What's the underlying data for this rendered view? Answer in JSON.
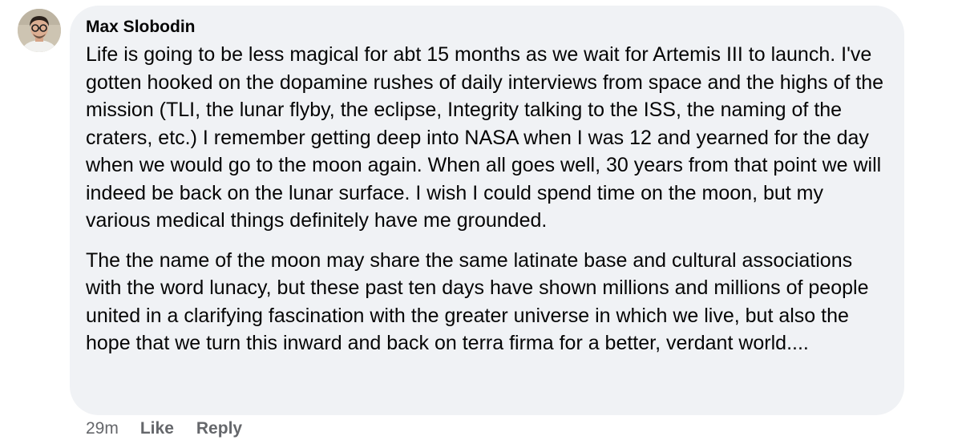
{
  "comment": {
    "author": "Max Slobodin",
    "avatar_icon": "user-avatar-photo",
    "paragraphs": [
      "Life is going to be less magical for abt 15 months as we wait for Artemis III to launch. I've gotten hooked on the dopamine rushes of daily interviews from space and the highs of the mission (TLI, the lunar flyby, the eclipse, Integrity talking to the ISS, the naming of the craters, etc.) I remember getting deep into NASA when I was 12 and yearned for the day when we would go to the moon again. When all goes well, 30 years from that point we will indeed be back on the lunar surface. I wish I could spend time on the moon, but my various medical things definitely have me grounded.",
      "The the name of the moon may share the same latinate base and cultural associations with the word lunacy, but these past ten days have shown millions and millions of people united in a clarifying fascination with the greater universe in which we live, but also the hope that we turn this inward and back on terra firma for a better, verdant world...."
    ],
    "timestamp": "29m",
    "like_label": "Like",
    "reply_label": "Reply"
  },
  "colors": {
    "bubble_background": "#f0f2f5",
    "text": "#050505",
    "meta_text": "#65676b"
  }
}
